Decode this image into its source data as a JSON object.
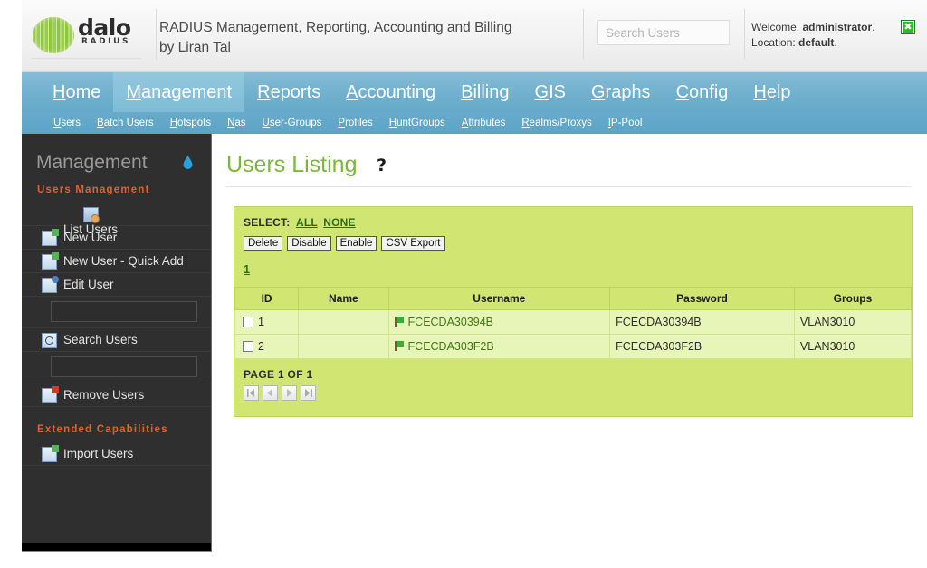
{
  "header": {
    "logo_word": "dalo",
    "logo_sub": "RADIUS",
    "title_line1": "RADIUS Management, Reporting, Accounting and Billing",
    "title_line2": "by Liran Tal",
    "search_placeholder": "Search Users",
    "search_value": "",
    "welcome_prefix": "Welcome, ",
    "welcome_user": "administrator",
    "welcome_suffix": ".",
    "location_prefix": "Location: ",
    "location_value": "default",
    "location_suffix": ".",
    "logout_glyph": "✖"
  },
  "nav": {
    "items": [
      {
        "label": "Home",
        "accesskey": "H",
        "active": false
      },
      {
        "label": "Management",
        "accesskey": "M",
        "active": true
      },
      {
        "label": "Reports",
        "accesskey": "R",
        "active": false
      },
      {
        "label": "Accounting",
        "accesskey": "A",
        "active": false
      },
      {
        "label": "Billing",
        "accesskey": "B",
        "active": false
      },
      {
        "label": "GIS",
        "accesskey": "G",
        "active": false
      },
      {
        "label": "Graphs",
        "accesskey": "G",
        "active": false
      },
      {
        "label": "Config",
        "accesskey": "C",
        "active": false
      },
      {
        "label": "Help",
        "accesskey": "H",
        "active": false
      }
    ]
  },
  "subnav": {
    "items": [
      {
        "label": "Users"
      },
      {
        "label": "Batch Users"
      },
      {
        "label": "Hotspots"
      },
      {
        "label": "Nas"
      },
      {
        "label": "User-Groups"
      },
      {
        "label": "Profiles"
      },
      {
        "label": "HuntGroups"
      },
      {
        "label": "Attributes"
      },
      {
        "label": "Realms/Proxys"
      },
      {
        "label": "IP-Pool"
      }
    ]
  },
  "sidebar": {
    "title": "Management",
    "section_1": "Users Management",
    "section_2": "Extended Capabilities",
    "items_1": [
      {
        "label": "List Users",
        "icon": "list-users-icon"
      },
      {
        "label": "New User",
        "icon": "new-user-icon"
      },
      {
        "label": "New User - Quick Add",
        "icon": "new-user-quick-add-icon"
      },
      {
        "label": "Edit User",
        "icon": "edit-user-icon"
      }
    ],
    "edit_user_input": "",
    "search_item": {
      "label": "Search Users",
      "icon": "search-users-icon"
    },
    "search_input": "",
    "remove_item": {
      "label": "Remove Users",
      "icon": "remove-users-icon"
    },
    "items_2": [
      {
        "label": "Import Users",
        "icon": "import-users-icon"
      }
    ]
  },
  "main": {
    "page_title": "Users Listing",
    "help_glyph": "?",
    "select_label": "SELECT:",
    "select_all": "ALL",
    "select_none": "NONE",
    "buttons": [
      {
        "label": "Delete"
      },
      {
        "label": "Disable"
      },
      {
        "label": "Enable"
      },
      {
        "label": "CSV Export"
      }
    ],
    "page_links": [
      "1"
    ],
    "table": {
      "columns": [
        "ID",
        "Name",
        "Username",
        "Password",
        "Groups"
      ],
      "rows": [
        {
          "id": "1",
          "name": "",
          "username": "FCECDA30394B",
          "password": "FCECDA30394B",
          "groups": "VLAN3010"
        },
        {
          "id": "2",
          "name": "",
          "username": "FCECDA303F2B",
          "password": "FCECDA303F2B",
          "groups": "VLAN3010"
        }
      ]
    },
    "footer_label": "PAGE 1 OF 1",
    "pager": [
      {
        "name": "first-page-button"
      },
      {
        "name": "previous-page-button"
      },
      {
        "name": "next-page-button"
      },
      {
        "name": "last-page-button"
      }
    ]
  },
  "colors": {
    "accent_green": "#7cb63c",
    "panel_green": "#d0e572",
    "row_green": "#e8f5b8",
    "nav_blue": "#72b1cf",
    "sidebar_dark": "#2f2f2f",
    "section_orange": "#e2622a"
  }
}
